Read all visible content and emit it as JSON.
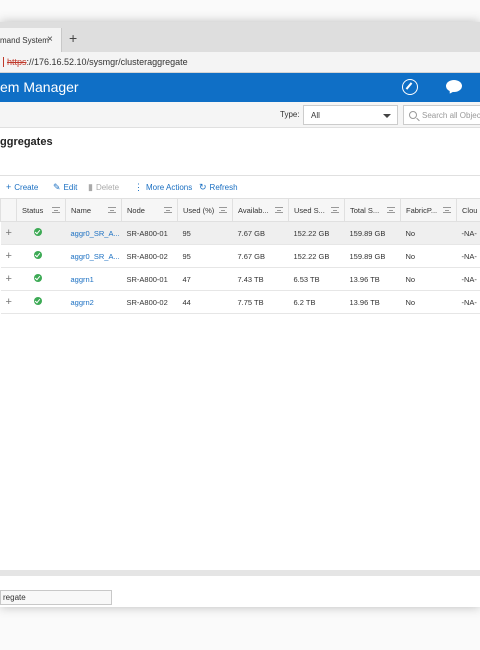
{
  "browser": {
    "tab_title": "mand System",
    "tab_close": "×",
    "new_tab": "+",
    "url_scheme": "https",
    "url_rest": "://176.16.52.10/sysmgr/clusteraggregate",
    "status_url": "regate"
  },
  "app": {
    "title": "em Manager"
  },
  "filter": {
    "type_label": "Type:",
    "type_value": "All",
    "search_placeholder": "Search all Objects"
  },
  "page": {
    "title": "ggregates"
  },
  "toolbar": {
    "create": "Create",
    "edit": "Edit",
    "delete": "Delete",
    "more_actions": "More Actions",
    "refresh": "Refresh"
  },
  "table": {
    "columns": [
      "",
      "Status",
      "Name",
      "Node",
      "Used (%)",
      "Availab...",
      "Used S...",
      "Total S...",
      "FabricP...",
      "Clou"
    ],
    "rows": [
      {
        "expand": "+",
        "name": "aggr0_SR_A...",
        "node": "SR-A800-01",
        "used_pct": "95",
        "available": "7.67 GB",
        "used_space": "152.22 GB",
        "total_space": "159.89 GB",
        "fabricpool": "No",
        "cloud": "-NA-"
      },
      {
        "expand": "+",
        "name": "aggr0_SR_A...",
        "node": "SR-A800-02",
        "used_pct": "95",
        "available": "7.67 GB",
        "used_space": "152.22 GB",
        "total_space": "159.89 GB",
        "fabricpool": "No",
        "cloud": "-NA-"
      },
      {
        "expand": "+",
        "name": "aggrn1",
        "node": "SR-A800-01",
        "used_pct": "47",
        "available": "7.43 TB",
        "used_space": "6.53 TB",
        "total_space": "13.96 TB",
        "fabricpool": "No",
        "cloud": "-NA-"
      },
      {
        "expand": "+",
        "name": "aggrn2",
        "node": "SR-A800-02",
        "used_pct": "44",
        "available": "7.75 TB",
        "used_space": "6.2 TB",
        "total_space": "13.96 TB",
        "fabricpool": "No",
        "cloud": "-NA-"
      }
    ]
  },
  "colors": {
    "appbar": "#0f6fc6",
    "link": "#1a6fc2",
    "status_ok": "#3daa55"
  },
  "icons": [
    "close-icon",
    "plus-icon",
    "compass-icon",
    "chat-icon",
    "search-icon",
    "caret-down-icon",
    "create-icon",
    "edit-icon",
    "delete-icon",
    "more-actions-icon",
    "refresh-icon",
    "filter-icon",
    "status-ok-icon",
    "expand-icon"
  ]
}
